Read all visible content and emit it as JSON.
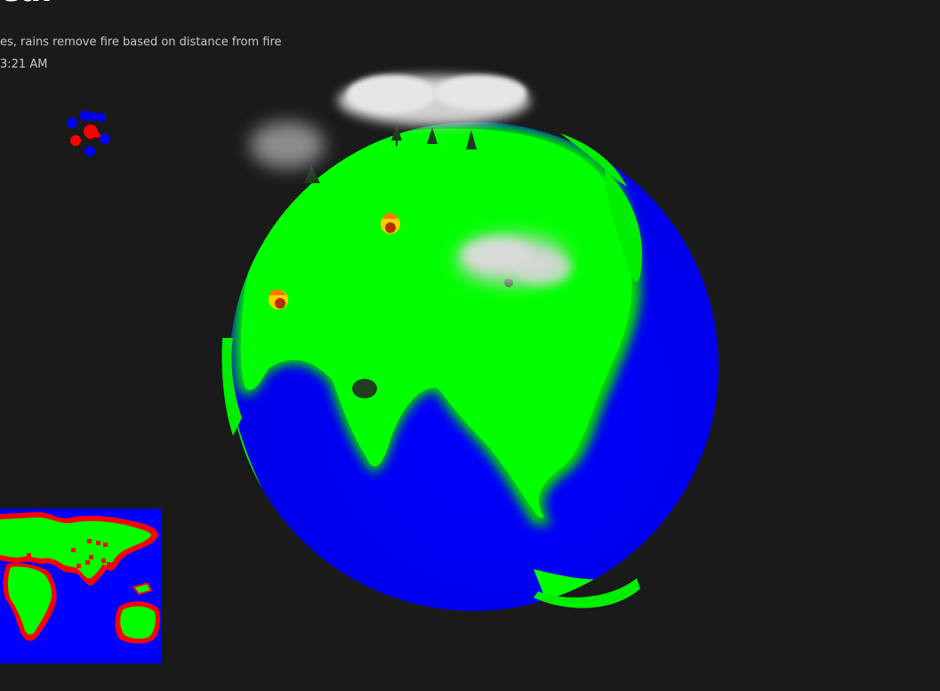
{
  "header": {
    "title": "ea.",
    "description": "es, rains remove fire based on distance from fire",
    "timestamp": "3:21 AM"
  },
  "colors": {
    "background": "#1a1a1a",
    "ocean": "#0000ff",
    "land": "#00ff00",
    "fire": "#ff0000",
    "cloud": "#d9d9d9"
  },
  "legend_dots": {
    "red_count": 3,
    "blue_count": 6
  },
  "globe": {
    "fires_visible": 2,
    "clouds_visible": 3,
    "trees_visible": 5
  },
  "minimap": {
    "fire_markers": 10
  }
}
